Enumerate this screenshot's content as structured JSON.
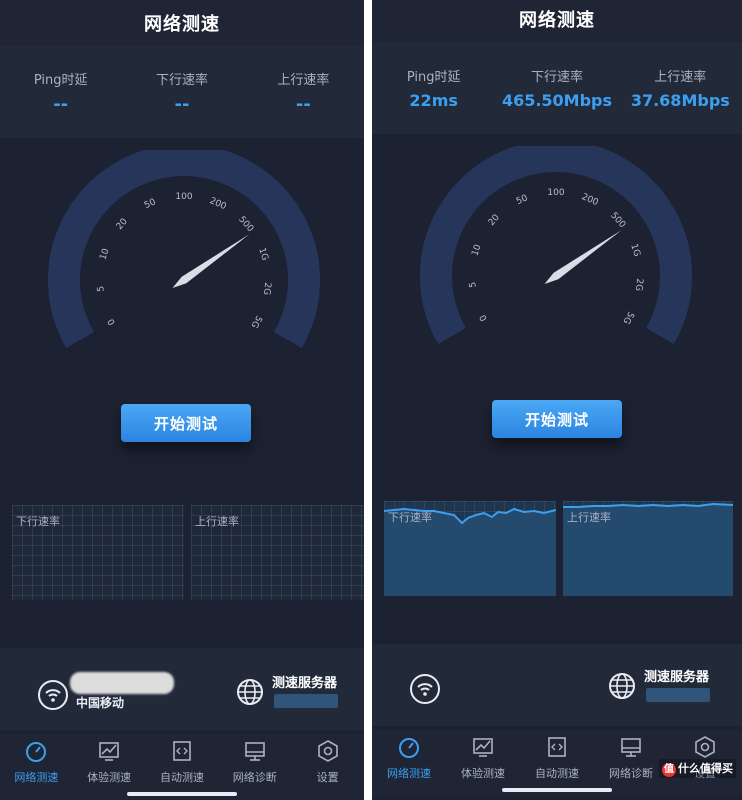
{
  "left": {
    "title": "网络测速",
    "stats": [
      {
        "label": "Ping时延",
        "value": "--"
      },
      {
        "label": "下行速率",
        "value": "--"
      },
      {
        "label": "上行速率",
        "value": "--"
      }
    ],
    "start_button": "开始测试",
    "down_chart_label": "下行速率",
    "up_chart_label": "上行速率",
    "carrier": "中国移动",
    "server_label": "测速服务器"
  },
  "right": {
    "title": "网络测速",
    "stats": [
      {
        "label": "Ping时延",
        "value": "22ms"
      },
      {
        "label": "下行速率",
        "value": "465.50Mbps"
      },
      {
        "label": "上行速率",
        "value": "37.68Mbps"
      }
    ],
    "start_button": "开始测试",
    "down_chart_label": "下行速率",
    "up_chart_label": "上行速率",
    "server_label": "测速服务器"
  },
  "gauge": {
    "ticks": [
      "0",
      "5",
      "10",
      "20",
      "50",
      "100",
      "200",
      "500",
      "1G",
      "2G",
      "5G"
    ]
  },
  "tabs": [
    {
      "label": "网络测速",
      "icon": "speedometer-icon"
    },
    {
      "label": "体验测速",
      "icon": "chart-icon"
    },
    {
      "label": "自动测速",
      "icon": "code-doc-icon"
    },
    {
      "label": "网络诊断",
      "icon": "monitor-icon"
    },
    {
      "label": "设置",
      "icon": "settings-icon"
    }
  ],
  "watermark": "什么值得买",
  "colors": {
    "accent": "#3d9ff0",
    "bg": "#1c2232",
    "gauge_arc": "#26355a"
  }
}
